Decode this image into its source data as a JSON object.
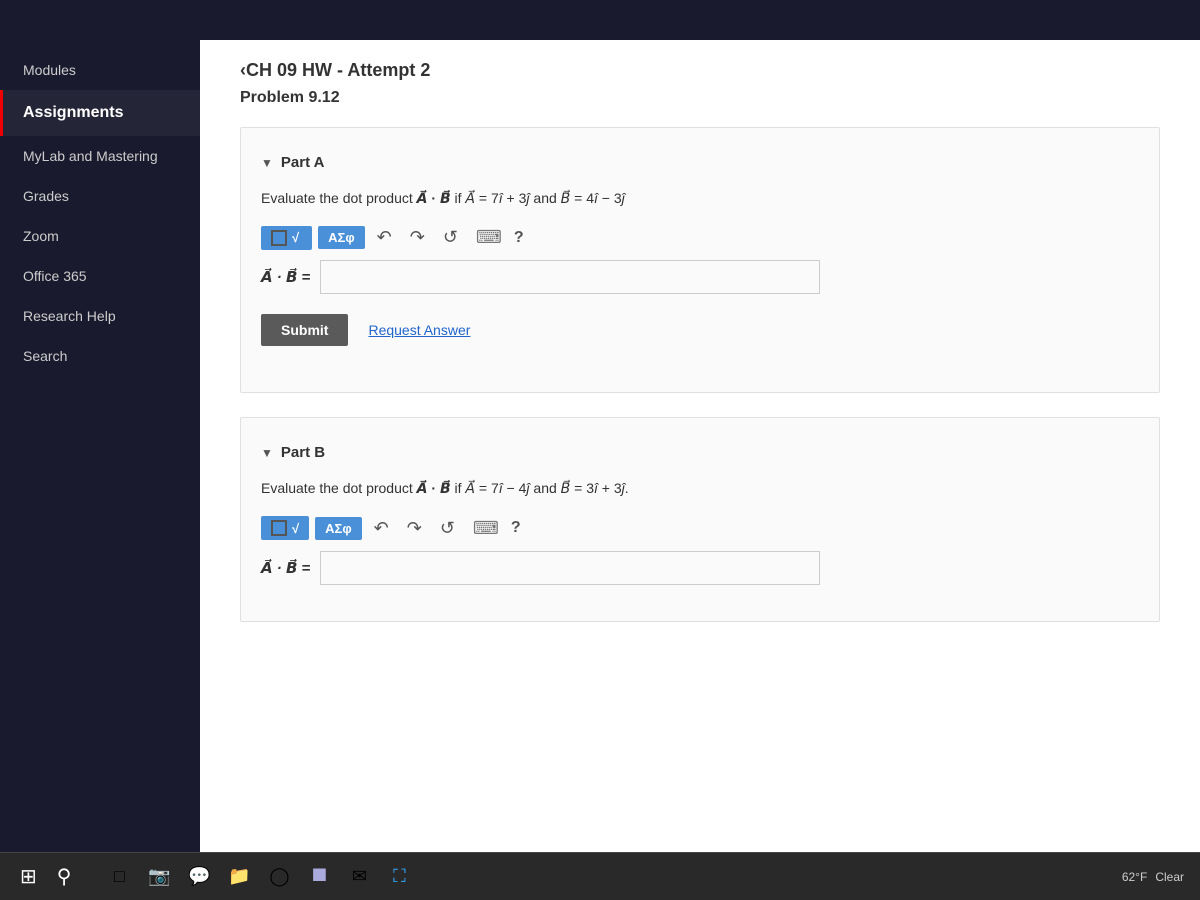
{
  "sidebar": {
    "items": [
      {
        "id": "modules",
        "label": "Modules",
        "active": false
      },
      {
        "id": "assignments",
        "label": "Assignments",
        "active": true
      },
      {
        "id": "mylab",
        "label": "MyLab and Mastering",
        "active": false
      },
      {
        "id": "grades",
        "label": "Grades",
        "active": false
      },
      {
        "id": "zoom",
        "label": "Zoom",
        "active": false
      },
      {
        "id": "office365",
        "label": "Office 365",
        "active": false
      },
      {
        "id": "research",
        "label": "Research Help",
        "active": false
      },
      {
        "id": "search",
        "label": "Search",
        "active": false
      }
    ]
  },
  "header": {
    "hw_title": "‹CH 09 HW - Attempt 2",
    "problem_title": "Problem 9.12"
  },
  "part_a": {
    "label": "Part A",
    "description": "Evaluate the dot product A⃗ · B⃗ if A⃗ = 7î + 3ĵ and B⃗ = 4î − 3ĵ",
    "toolbar": {
      "sqrt_label": "√",
      "greek_label": "ΑΣφ"
    },
    "answer_label": "A⃗ · B⃗ =",
    "answer_value": "",
    "answer_placeholder": "",
    "submit_label": "Submit",
    "request_answer_label": "Request Answer",
    "icons": {
      "undo": "↶",
      "redo": "↷",
      "refresh": "↺",
      "keyboard": "⌨",
      "question": "?"
    }
  },
  "part_b": {
    "label": "Part B",
    "description": "Evaluate the dot product A⃗ · B⃗ if A⃗ = 7î − 4ĵ and B⃗ = 3î + 3ĵ.",
    "toolbar": {
      "sqrt_label": "√",
      "greek_label": "ΑΣφ"
    },
    "answer_label": "A⃗ · B⃗ =",
    "answer_value": "",
    "answer_placeholder": "",
    "icons": {
      "undo": "↶",
      "redo": "↷",
      "refresh": "↺",
      "keyboard": "⌨",
      "question": "?"
    }
  },
  "taskbar": {
    "weather": "62°F",
    "weather_label": "Clear",
    "icons": [
      "⊞",
      "🔍",
      "□",
      "📷",
      "📁",
      "○",
      "⊞",
      "✉",
      "🌐"
    ]
  }
}
